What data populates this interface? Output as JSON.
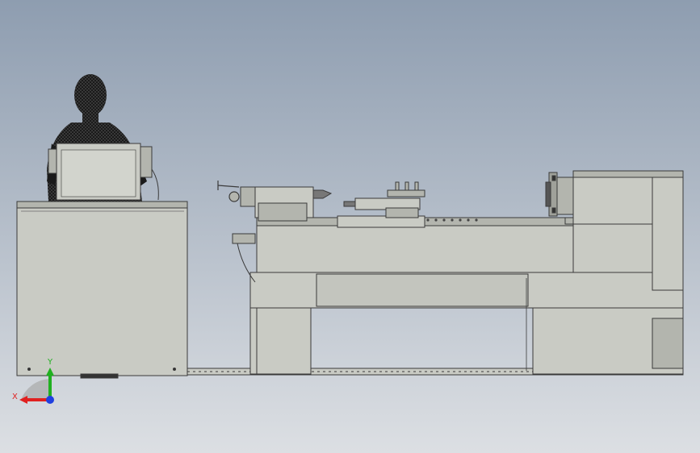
{
  "viewport": {
    "background_top": "#8e9db0",
    "background_bottom": "#dcdfe3"
  },
  "triad": {
    "x_label": "X",
    "y_label": "Y",
    "x_color": "#e02020",
    "y_color": "#20b020",
    "z_color": "#2040e0"
  },
  "palette": {
    "metal": "#c9cbc4",
    "metal_dark": "#b3b5ae",
    "edge": "#3a3a3a",
    "silhouette": "#141414",
    "floor_line": "#6a6a6a"
  },
  "icons": [
    "operator-silhouette-icon",
    "handwheel-icon",
    "chuck-icon",
    "tool-post-icon",
    "coordinate-triad-icon"
  ]
}
